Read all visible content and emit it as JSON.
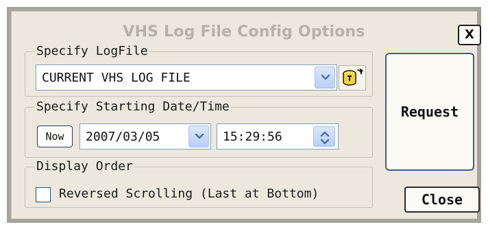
{
  "dialog": {
    "title": "VHS Log File Config Options",
    "close_x": "X"
  },
  "logfile": {
    "group_label": "Specify LogFile",
    "selected": "CURRENT VHS LOG FILE",
    "dropdown_icon": "chevron-down-icon",
    "refresh_icon": "refresh-database-icon"
  },
  "start": {
    "group_label": "Specify Starting Date/Time",
    "now_label": "Now",
    "date": "2007/03/05",
    "time": "15:29:56"
  },
  "order": {
    "group_label": "Display Order",
    "checkbox_label": "Reversed Scrolling (Last at Bottom)",
    "checked": false
  },
  "buttons": {
    "request": "Request",
    "close": "Close"
  },
  "colors": {
    "dialog_bg": "#ece8dd",
    "title_color": "#b5b1a6",
    "dropdown_blue": "#b9cff5",
    "accent_border": "#3f5e95"
  }
}
